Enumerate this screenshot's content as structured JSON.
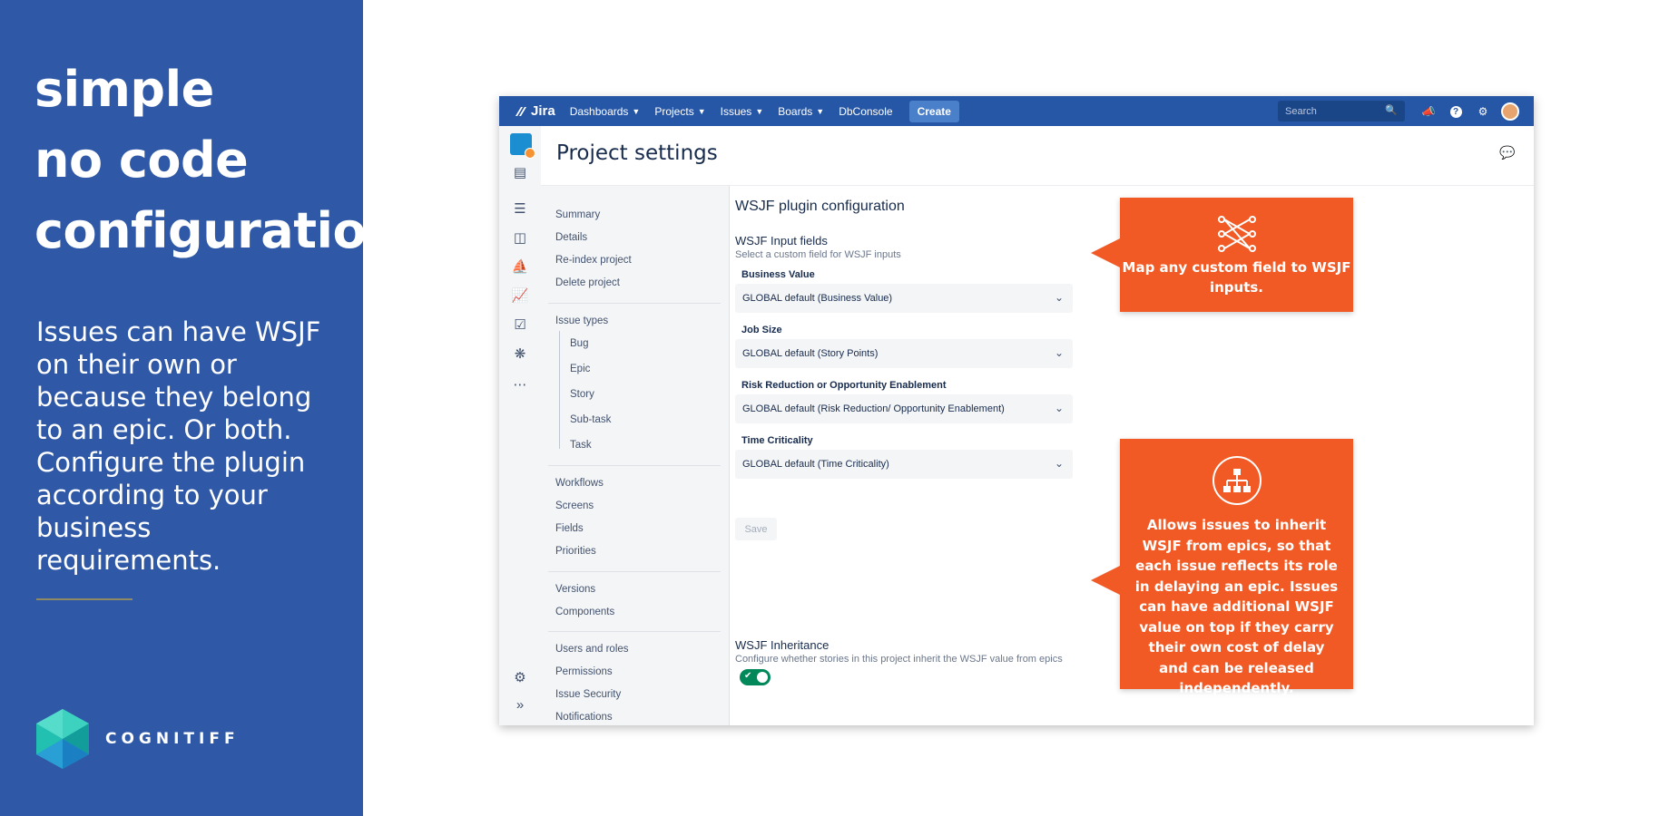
{
  "slide": {
    "headline": [
      "simple",
      "no code",
      "configuration"
    ],
    "blurb": "Issues can have WSJF on their own or because they belong to an epic. Or both. Configure the plugin according to your business requirements.",
    "logo_text": "COGNITIFF",
    "background_color": "#2f58a6",
    "callout_color": "#f15a24"
  },
  "topbar": {
    "product": "Jira",
    "nav": [
      "Dashboards",
      "Projects",
      "Issues",
      "Boards",
      "DbConsole"
    ],
    "create_label": "Create",
    "search_placeholder": "Search"
  },
  "page": {
    "title": "Project settings"
  },
  "settings_nav": {
    "group1": [
      "Summary",
      "Details",
      "Re-index project",
      "Delete project"
    ],
    "issue_types_label": "Issue types",
    "issue_types": [
      "Bug",
      "Epic",
      "Story",
      "Sub-task",
      "Task"
    ],
    "group3": [
      "Workflows",
      "Screens",
      "Fields",
      "Priorities"
    ],
    "group4": [
      "Versions",
      "Components"
    ],
    "group5": [
      "Users and roles",
      "Permissions",
      "Issue Security",
      "Notifications"
    ]
  },
  "config": {
    "title": "WSJF plugin configuration",
    "inputs_heading": "WSJF Input fields",
    "inputs_sub": "Select a custom field for WSJF inputs",
    "fields": [
      {
        "label": "Business Value",
        "value": "GLOBAL default (Business Value)"
      },
      {
        "label": "Job Size",
        "value": "GLOBAL default (Story Points)"
      },
      {
        "label": "Risk Reduction or Opportunity Enablement",
        "value": "GLOBAL default (Risk Reduction/ Opportunity Enablement)"
      },
      {
        "label": "Time Criticality",
        "value": "GLOBAL default (Time Criticality)"
      }
    ],
    "save_label": "Save",
    "inheritance_heading": "WSJF Inheritance",
    "inheritance_sub": "Configure whether stories in this project inherit the WSJF value from epics",
    "inheritance_enabled": true
  },
  "callouts": {
    "mapping": "Map any custom  field to WSJF inputs.",
    "inheritance": "Allows issues to inherit WSJF from epics, so that each issue reflects its role in delaying an epic. Issues can have additional WSJF value on top if they carry their own cost of delay and can be released independently."
  }
}
